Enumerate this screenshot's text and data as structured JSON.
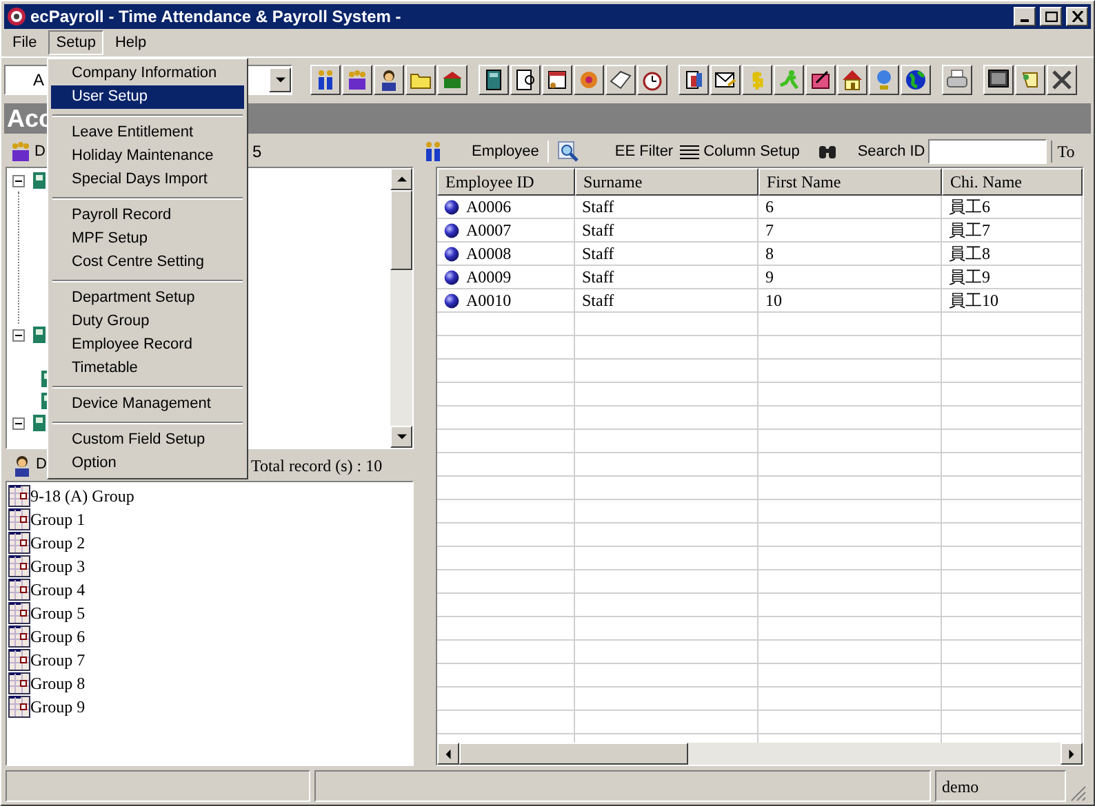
{
  "window": {
    "title": "ecPayroll - Time Attendance & Payroll System -"
  },
  "menu_bar": [
    {
      "label": "File",
      "selected": false
    },
    {
      "label": "Setup",
      "selected": true
    },
    {
      "label": "Help",
      "selected": false
    }
  ],
  "setup_menu": {
    "groups": [
      [
        {
          "label": "Company Information",
          "selected": false
        },
        {
          "label": "User Setup",
          "selected": true
        }
      ],
      [
        {
          "label": "Leave Entitlement",
          "selected": false
        },
        {
          "label": "Holiday Maintenance",
          "selected": false
        },
        {
          "label": "Special Days Import",
          "selected": false
        }
      ],
      [
        {
          "label": "Payroll Record",
          "selected": false
        },
        {
          "label": "MPF Setup",
          "selected": false
        },
        {
          "label": "Cost Centre Setting",
          "selected": false
        }
      ],
      [
        {
          "label": "Department Setup",
          "selected": false
        },
        {
          "label": "Duty Group",
          "selected": false
        },
        {
          "label": "Employee Record",
          "selected": false
        },
        {
          "label": "Timetable",
          "selected": false
        }
      ],
      [
        {
          "label": "Device Management",
          "selected": false
        }
      ],
      [
        {
          "label": "Custom Field Setup",
          "selected": false
        },
        {
          "label": "Option",
          "selected": false
        }
      ]
    ]
  },
  "company_combo": {
    "value": "A"
  },
  "banner": {
    "title": "Acc"
  },
  "department_panel": {
    "label": "D",
    "count": "5",
    "tree": [
      {
        "expanded": true
      },
      {
        "expanded": true
      },
      {
        "expanded": true
      }
    ]
  },
  "duty_panel": {
    "label": "D",
    "record_count": "Total record (s) : 10",
    "groups": [
      "9-18 (A) Group",
      "Group 1",
      "Group 2",
      "Group 3",
      "Group 4",
      "Group 5",
      "Group 6",
      "Group 7",
      "Group 8",
      "Group 9"
    ]
  },
  "employee_toolbar": {
    "employee": "Employee",
    "filter": "EE Filter",
    "columns": "Column Setup",
    "search_label": "Search ID",
    "to_label": "To"
  },
  "table": {
    "columns": [
      "Employee ID",
      "Surname",
      "First Name",
      "Chi. Name"
    ],
    "rows": [
      [
        "A0006",
        "Staff",
        "6",
        "員工6"
      ],
      [
        "A0007",
        "Staff",
        "7",
        "員工7"
      ],
      [
        "A0008",
        "Staff",
        "8",
        "員工8"
      ],
      [
        "A0009",
        "Staff",
        "9",
        "員工9"
      ],
      [
        "A0010",
        "Staff",
        "10",
        "員工10"
      ]
    ]
  },
  "status_bar": {
    "user": "demo"
  }
}
